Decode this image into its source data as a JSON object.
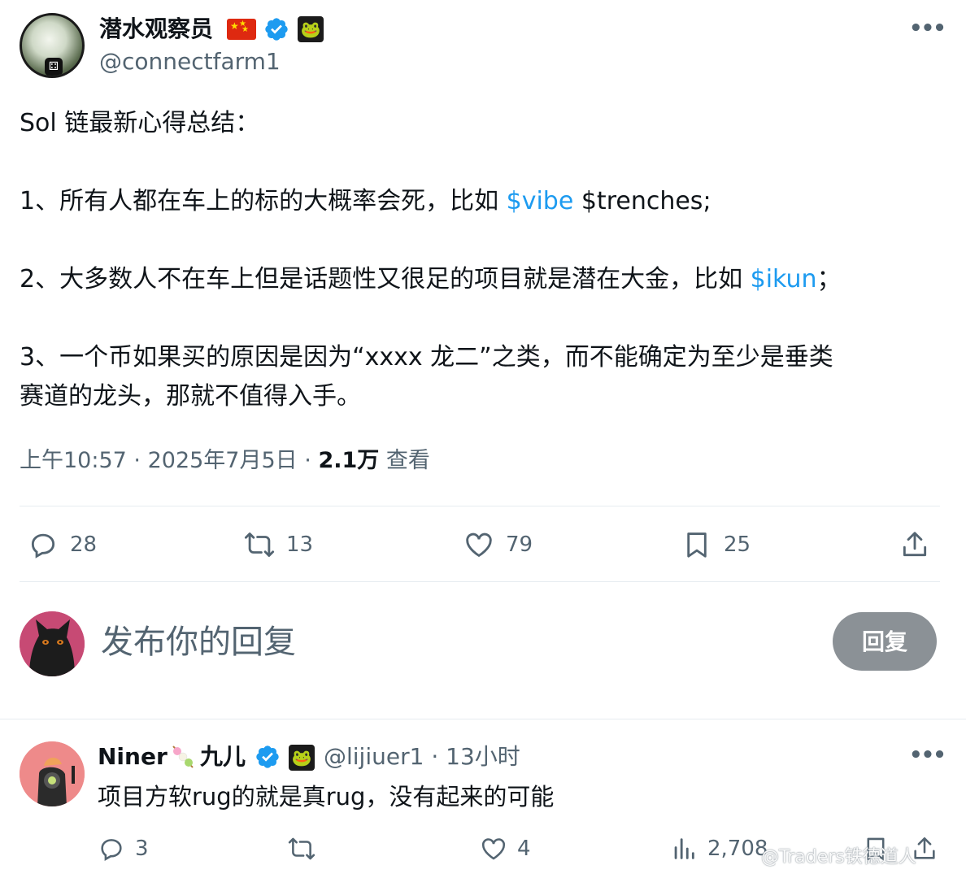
{
  "author": {
    "display_name": "潜水观察员",
    "handle": "@connectfarm1",
    "flag": "china-flag",
    "verified_icon": "verified-badge-icon",
    "org_icon": "frog-badge-icon"
  },
  "tweet": {
    "lines": [
      {
        "text": "Sol 链最新心得总结："
      },
      {
        "pre": "1、所有人都在车上的标的大概率会死，比如 ",
        "tag": "$vibe",
        "post": " $trenches;"
      },
      {
        "pre": "2、大多数人不在车上但是话题性又很足的项目就是潜在大金，比如 ",
        "tag": "$ikun",
        "post": "；"
      },
      {
        "text": "3、一个币如果买的原因是因为“xxxx 龙二”之类，而不能确定为至少是垂类"
      },
      {
        "text": "赛道的龙头，那就不值得入手。"
      }
    ],
    "time": "上午10:57",
    "date": "2025年7月5日",
    "views": "2.1万",
    "views_label": "查看",
    "sep": "·"
  },
  "actions": {
    "replies": "28",
    "retweets": "13",
    "likes": "79",
    "bookmarks": "25"
  },
  "composer": {
    "placeholder": "发布你的回复",
    "button_label": "回复"
  },
  "reply": {
    "name": "Niner",
    "name2": "九儿",
    "handle": "@lijiuer1",
    "time": "13小时",
    "text": "项目方软rug的就是真rug，没有起来的可能",
    "replies": "3",
    "likes": "4",
    "views": "2,708"
  },
  "watermark": "@Traders铁德道人",
  "colors": {
    "link": "#1d9bf0",
    "secondary_text": "#536471",
    "reply_button_bg": "#8b9196",
    "verified": "#1d9bf0"
  }
}
